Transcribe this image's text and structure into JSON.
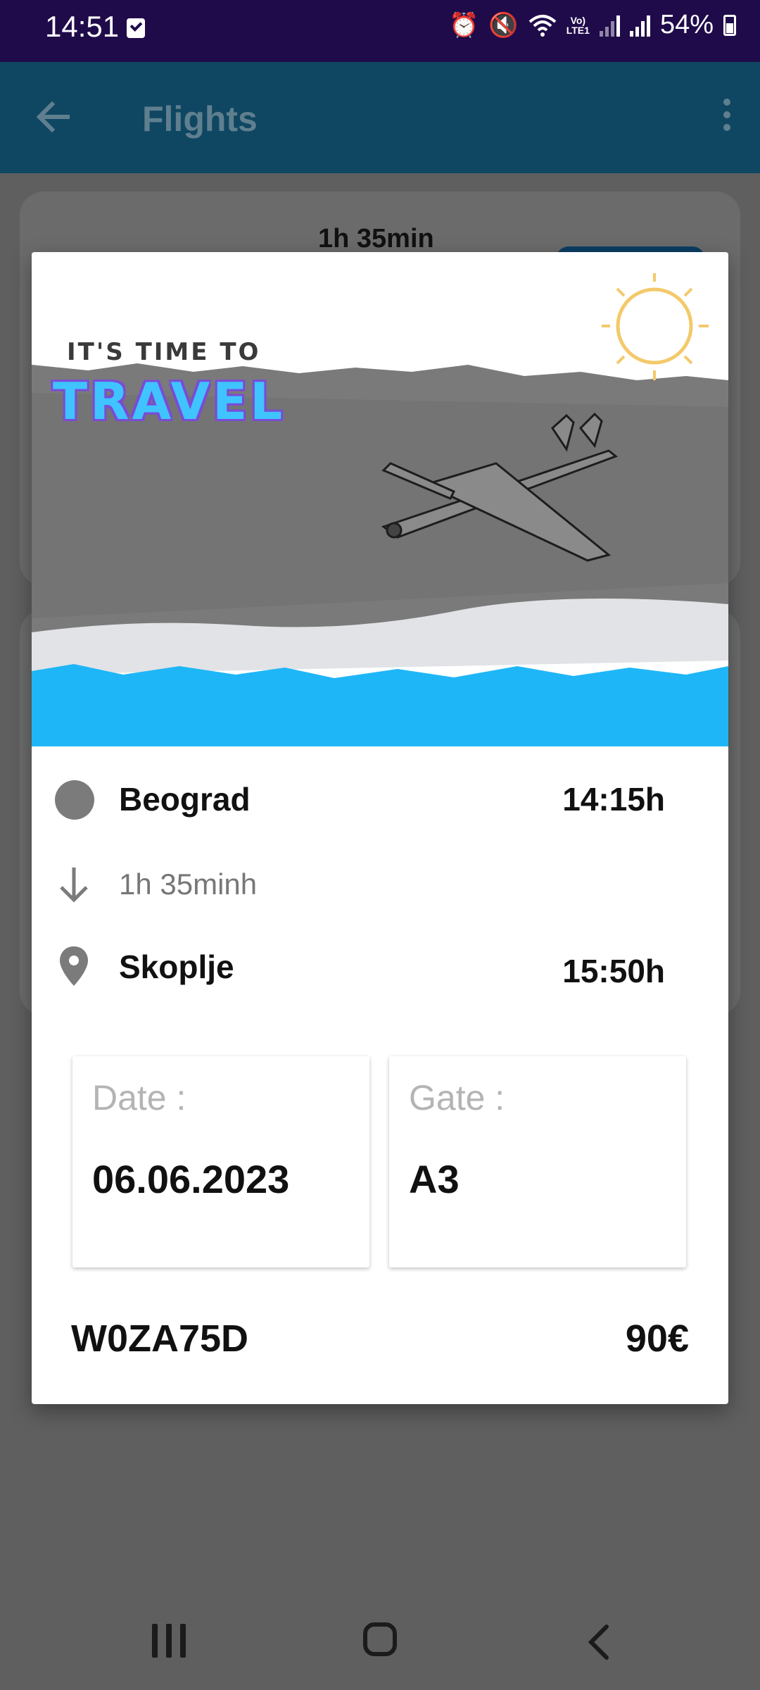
{
  "status_bar": {
    "time": "14:51",
    "battery": "54%",
    "volte_line1": "Vo)",
    "volte_line2": "LTE1"
  },
  "app_bar": {
    "title": "Flights"
  },
  "background_card": {
    "duration": "1h 35min"
  },
  "banner": {
    "subtitle": "IT'S TIME TO",
    "title": "TRAVEL"
  },
  "route": {
    "origin": {
      "city": "Beograd",
      "time": "14:15h"
    },
    "duration": "1h 35minh",
    "destination": {
      "city": "Skoplje",
      "time": "15:50h"
    }
  },
  "details": {
    "date_label": "Date :",
    "date_value": "06.06.2023",
    "gate_label": "Gate :",
    "gate_value": "A3"
  },
  "ticket": {
    "code": "W0ZA75D",
    "price": "90€"
  },
  "colors": {
    "status_bar": "#1f0b4a",
    "app_bar_dimmed": "#0f4762",
    "scrim_background": "#5f5f5f",
    "banner_blue": "#1fb6f7",
    "travel_text": "#3fc4ff"
  }
}
